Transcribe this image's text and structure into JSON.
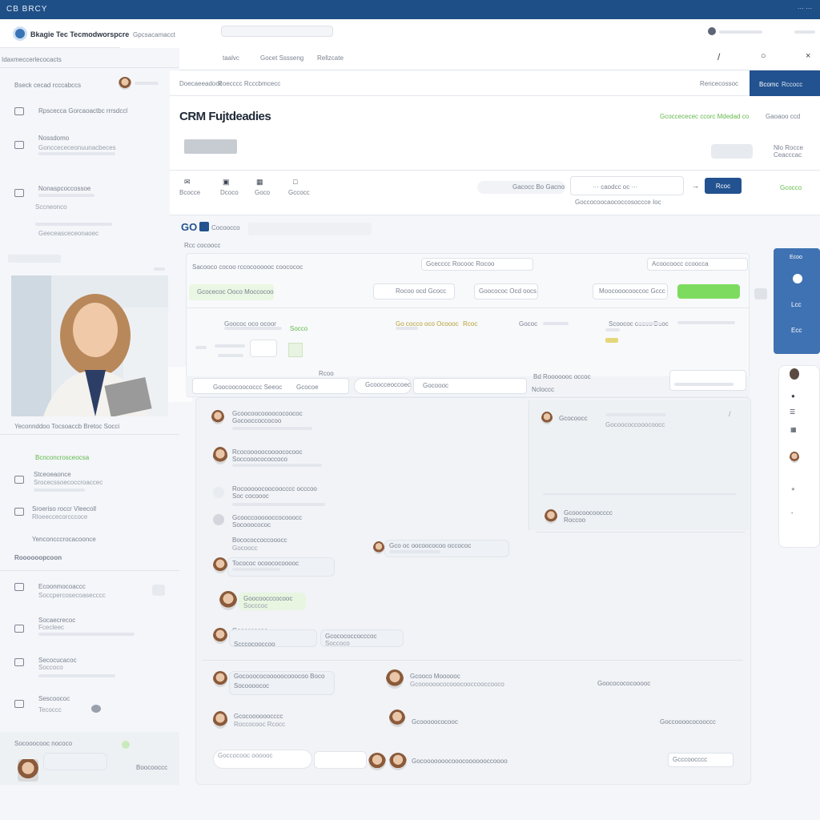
{
  "topbar": {
    "brand": "CB BRCY",
    "right_text": "··· ···"
  },
  "appbar": {
    "app_name": "Bkagie Tec Tecmodworspcre",
    "section": "Gpcsacamacct"
  },
  "subnav": {
    "items": [
      "taalvc",
      "Gocet Sssseng",
      "Rellzcate"
    ]
  },
  "sidebar": {
    "top_label": "Idaxmeccerlecocacts",
    "user_label": "Bseck cecad rcccabccs",
    "items": [
      {
        "title": "Rpscecca Gorcaoactbc rrrsdccl",
        "sub": ""
      },
      {
        "title": "Nossdomo",
        "sub": "Gonccececeonuunacbeces"
      },
      {
        "title": "Nonaspcoccossoe",
        "sub": "Sccneonco"
      },
      {
        "title": "",
        "sub": "Geeceasceceonaoec"
      }
    ],
    "photo_caption": "Yeconnddoo Tocsoaccb Bretoc Socci",
    "green_link": "Bcnconcrosceocsa",
    "list": [
      {
        "title": "Stceoeaonce",
        "sub": "Srocecssoecoccroaccec"
      },
      {
        "title": "Sroeriso roccr Vleecoll",
        "sub": "Rloeeccecorcccoce"
      },
      {
        "title": "Yenconcccrocacoonce",
        "sub": ""
      }
    ],
    "section2": "Roooooopcoon",
    "list2": [
      {
        "title": "Ecoonmocoaccc",
        "sub": "Soccpercosecoasecccc"
      },
      {
        "title": "Socaecrecoc",
        "sub": "Fcecleec"
      },
      {
        "title": "Secocucacoc",
        "sub": "Soccoco"
      },
      {
        "title": "Sescoococ",
        "sub": "Tecoccc"
      }
    ],
    "footer": {
      "name": "Socooocooc nococo",
      "meta": "Boocooccc"
    }
  },
  "header": {
    "breadcrumbs": [
      "Doecaeeadocc",
      "Roecccc Rcccbmcecc"
    ],
    "right_link": "Rencecossoc",
    "primary_button": "Bcomc",
    "secondary_button": "Rccocc"
  },
  "page": {
    "title": "CRM Fujtdeadies",
    "right_info": "Gcoccececec ccorc Mdedad co",
    "right_link": "Gaoaoo ccd",
    "filter_chip": "",
    "badge_label": "Nlo Rocce",
    "badge_sub": "Ceacccac"
  },
  "toolbar": {
    "icons": [
      {
        "label": "Bcocce",
        "icon": "mail-icon"
      },
      {
        "label": "Dcoco",
        "icon": "folder-icon"
      },
      {
        "label": "Goco",
        "icon": "chart-icon"
      },
      {
        "label": "Gccocc",
        "icon": "doc-icon"
      }
    ],
    "search_hint": "Gacocc Bo Gacno",
    "search_value": "··· caodcc oc ···",
    "search_sub": "Goccocoocaococcosoccce Ioc",
    "go_button": "Rcoc",
    "right_link": "Gcocco"
  },
  "panel": {
    "tag": "GO",
    "title": "Cocoocco",
    "sub": "Rcc cocoocc",
    "table_head": [
      "Sacooco cocoo rccocoooooc coocococ",
      "Gcecccc Rocooc Rocoo",
      "Acoocoocc ccoocca"
    ],
    "row1": [
      "Gcocecoc Ooco Moccocoo",
      "Rocoo ocd Gcocc",
      "Goocococ Ocd oocs",
      "Moocooocooccoc Gccc"
    ],
    "row2": [
      "Goococ oco ocoor",
      "Socco",
      "Go cocco oco Ocoooc",
      "Rcoc",
      "Gococ",
      "Scoococ ocoec Dcoc"
    ],
    "row3_label": "Rcoo",
    "row3": [
      "Goocoocoococcc Seeoc",
      "Gcocoe",
      "Gcoocceoccoec",
      "Gocoooc",
      "Ncloccc",
      "Bd Rooooooc occoc"
    ]
  },
  "right_widget": {
    "title": "Ecoo",
    "items": [
      "Lcc",
      "Ecc"
    ]
  },
  "chat": {
    "left": [
      {
        "name": "Gcoocoocoooococoococ",
        "text": "Gocooccoccocoo"
      },
      {
        "name": "Rcocooooocoooococooc",
        "text": "Soccooocococcoco"
      },
      {
        "name": "Rocooooocoocoocccc occcoo",
        "text": "Soc cocoooc"
      },
      {
        "name": "Gcooccoooooccocooocc",
        "text": "Socooocococ"
      },
      {
        "name": "Bocococcoccooocc",
        "text": "Gocoocc"
      }
    ],
    "right": [
      {
        "name": "Gcocoocc",
        "text": "Gocoococcooocoocc"
      },
      {
        "name": "Gcoocoocoocccc",
        "text": "Roccoo"
      }
    ],
    "mid": [
      {
        "name": "Gco oc oocoococoo occococ",
        "text": ""
      },
      {
        "name": "Tocococ ocoococooooc",
        "text": ""
      },
      {
        "name": "Goocoocccocooc",
        "text": "Socccoc"
      },
      {
        "name": "Goocccocoo",
        "text": "Scccocooccoo"
      },
      {
        "name": "Gcocococcocccoc",
        "text": "Soccoco"
      },
      {
        "name": "Gocooococooooocooocoo Boco",
        "text": "Socoooococ"
      },
      {
        "name": "Gcocoooooocccc",
        "text": "Roccocooc Rcocc"
      }
    ],
    "bottom_right": [
      {
        "name": "Gcooco Moooooc",
        "text": "Gcoooooococooocooccooccooco",
        "time": "Goococococooooc"
      },
      {
        "name": "Gcooooococooc",
        "text": "",
        "time": "Goccoooococooccc"
      },
      {
        "name": "Gocooooooocooocooooooccoooo",
        "text": "",
        "time": "Gcccoocccc"
      }
    ],
    "input_placeholder": "Goccocooc oooooc"
  },
  "colors": {
    "primary": "#22528f",
    "topbar": "#1f4f87",
    "accent_green": "#7ddc5f",
    "side_card": "#3f72b3"
  }
}
